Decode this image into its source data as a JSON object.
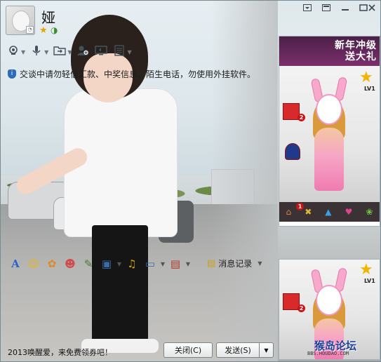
{
  "window": {
    "controls": {
      "menu_icon": "menu-dropdown-icon",
      "skin_icon": "skin-icon",
      "minimize_icon": "minimize-icon",
      "maximize_icon": "maximize-icon",
      "close_icon": "close-icon"
    }
  },
  "contact": {
    "name": "娅",
    "status_icons": [
      "star-icon",
      "moon-icon"
    ]
  },
  "top_toolbar": {
    "items": [
      {
        "icon": "camera-icon",
        "has_dropdown": true
      },
      {
        "icon": "microphone-icon",
        "has_dropdown": true
      },
      {
        "icon": "file-transfer-icon",
        "has_dropdown": true
      },
      {
        "icon": "add-member-icon",
        "has_dropdown": false
      },
      {
        "icon": "remote-desktop-icon",
        "has_dropdown": false
      },
      {
        "icon": "app-list-icon",
        "has_dropdown": true
      }
    ]
  },
  "notice": {
    "text": "交谈中请勿轻信汇款、中奖信息、陌生电话，勿使用外挂软件。"
  },
  "format_toolbar": {
    "items": [
      "font-icon",
      "smiley-icon",
      "wink-icon",
      "shake-icon",
      "pen-icon",
      "image-icon",
      "music-icon",
      "screenshot-icon",
      "gift-icon"
    ],
    "history_label": "消息记录"
  },
  "bottom": {
    "promo_text": "2013唤醒爱，来免费领券吧！",
    "close_label": "关闭(C)",
    "send_label": "发送(S)"
  },
  "ads": {
    "top": {
      "banner_text_line1": "新年冲级",
      "banner_text_line2": "送大礼",
      "level": "LV1",
      "gift_count": "2",
      "badge_count": "1"
    },
    "bottom": {
      "level": "LV1",
      "gift_count": "2",
      "logo_text": "猴岛论坛",
      "url_text": "BBS.HOUDAO.COM"
    }
  }
}
